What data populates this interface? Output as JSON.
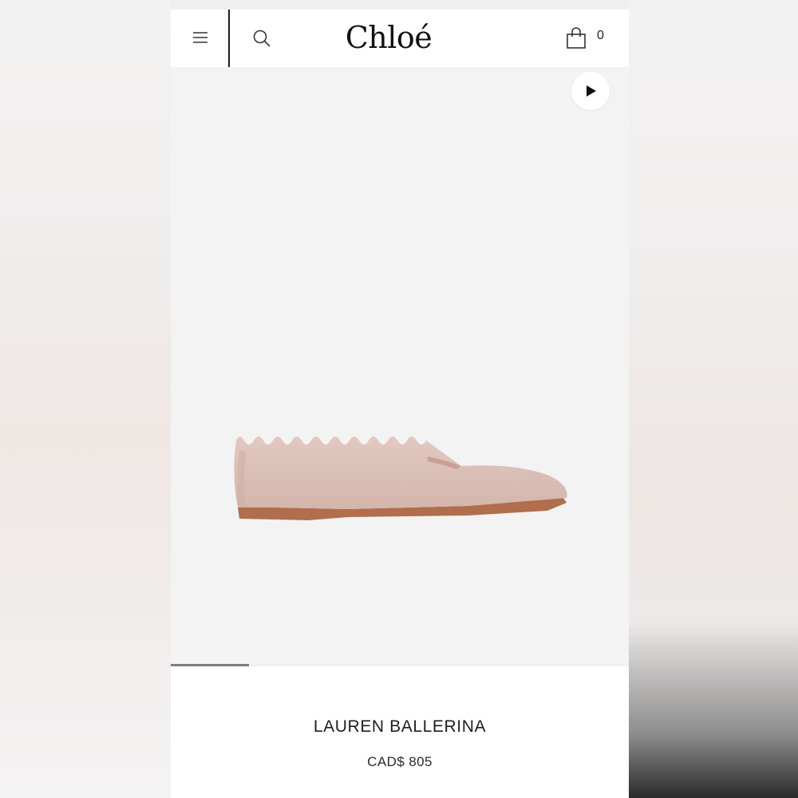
{
  "header": {
    "logo": "Chloé",
    "cart_count": "0",
    "icons": {
      "menu": "hamburger-menu-icon",
      "search": "search-icon",
      "cart": "shopping-bag-icon"
    }
  },
  "media": {
    "play_icon": "play-icon",
    "carousel_progress": 0.17
  },
  "product": {
    "name": "LAUREN BALLERINA",
    "price": "CAD$ 805"
  },
  "colors": {
    "shoe_leather": "#dcc1b8",
    "shoe_sole": "#b06e4c",
    "text": "#1e1e1e"
  }
}
